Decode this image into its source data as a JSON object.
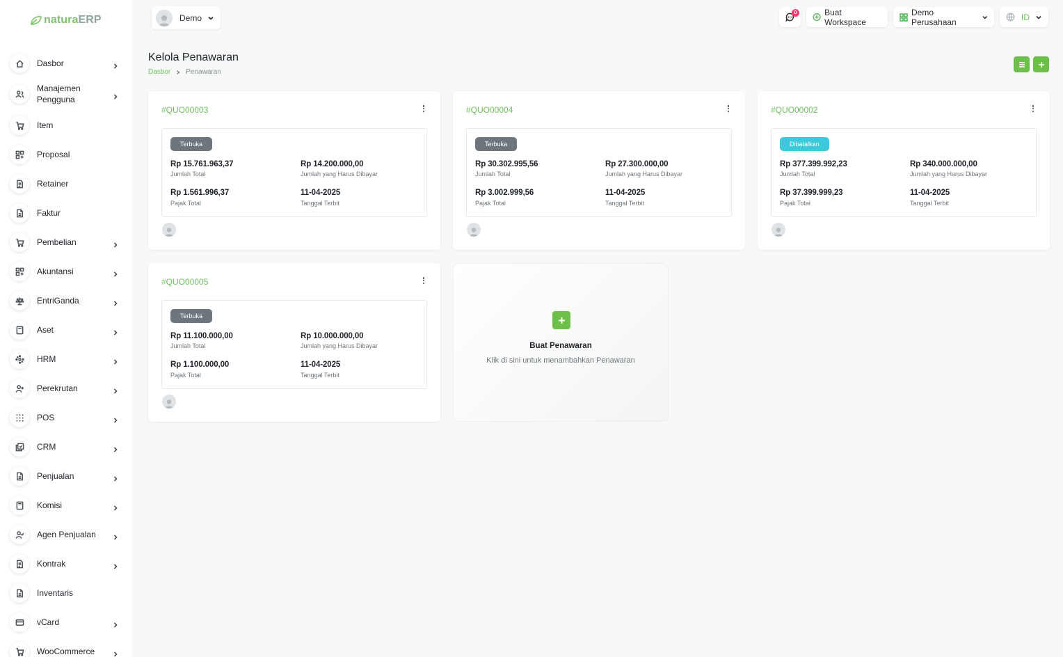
{
  "brand": {
    "part1": "natura",
    "part2": "ERP"
  },
  "sidebar": {
    "items": [
      {
        "label": "Dasbor",
        "icon": "home-icon",
        "chevron": true
      },
      {
        "label": "Manajemen Pengguna",
        "icon": "users-icon",
        "chevron": true
      },
      {
        "label": "Item",
        "icon": "cart-icon",
        "chevron": false
      },
      {
        "label": "Proposal",
        "icon": "grid-icon",
        "chevron": false
      },
      {
        "label": "Retainer",
        "icon": "file-icon",
        "chevron": false
      },
      {
        "label": "Faktur",
        "icon": "document-icon",
        "chevron": false
      },
      {
        "label": "Pembelian",
        "icon": "cart-icon",
        "chevron": true
      },
      {
        "label": "Akuntansi",
        "icon": "grid-icon",
        "chevron": true
      },
      {
        "label": "EntriGanda",
        "icon": "scale-icon",
        "chevron": true
      },
      {
        "label": "Aset",
        "icon": "calculator-icon",
        "chevron": true
      },
      {
        "label": "HRM",
        "icon": "network-icon",
        "chevron": true
      },
      {
        "label": "Perekrutan",
        "icon": "user-plus-icon",
        "chevron": true
      },
      {
        "label": "POS",
        "icon": "dots-grid-icon",
        "chevron": true
      },
      {
        "label": "CRM",
        "icon": "layers-icon",
        "chevron": true
      },
      {
        "label": "Penjualan",
        "icon": "document-icon",
        "chevron": true
      },
      {
        "label": "Komisi",
        "icon": "calculator-icon",
        "chevron": true
      },
      {
        "label": "Agen Penjualan",
        "icon": "user-check-icon",
        "chevron": true
      },
      {
        "label": "Kontrak",
        "icon": "file-icon",
        "chevron": true
      },
      {
        "label": "Inventaris",
        "icon": "document-icon",
        "chevron": false
      },
      {
        "label": "vCard",
        "icon": "card-icon",
        "chevron": true
      },
      {
        "label": "WooCommerce",
        "icon": "cart-icon",
        "chevron": true
      }
    ]
  },
  "topbar": {
    "user_name": "Demo",
    "notification_count": "0",
    "create_workspace": "Buat Workspace",
    "company": "Demo Perusahaan",
    "language": "ID"
  },
  "page": {
    "title": "Kelola Penawaran",
    "breadcrumb": {
      "home": "Dasbor",
      "current": "Penawaran"
    }
  },
  "labels": {
    "total": "Jumlah Total",
    "due": "Jumlah yang Harus Dibayar",
    "tax": "Pajak Total",
    "date": "Tanggal Terbit"
  },
  "quotes": [
    {
      "id": "#QUO00003",
      "status": "Terbuka",
      "total": "Rp 15.761.963,37",
      "due": "Rp 14.200.000,00",
      "tax": "Rp 1.561.996,37",
      "date": "11-04-2025"
    },
    {
      "id": "#QUO00004",
      "status": "Terbuka",
      "total": "Rp 30.302.995,56",
      "due": "Rp 27.300.000,00",
      "tax": "Rp 3.002.999,56",
      "date": "11-04-2025"
    },
    {
      "id": "#QUO00002",
      "status": "Dibatalkan",
      "total": "Rp 377.399.992,23",
      "due": "Rp 340.000.000,00",
      "tax": "Rp 37.399.999,23",
      "date": "11-04-2025"
    },
    {
      "id": "#QUO00005",
      "status": "Terbuka",
      "total": "Rp 11.100.000,00",
      "due": "Rp 10.000.000,00",
      "tax": "Rp 1.100.000,00",
      "date": "11-04-2025"
    }
  ],
  "create": {
    "title": "Buat Penawaran",
    "subtitle": "Klik di sini untuk menambahkan Penawaran"
  },
  "colors": {
    "accent": "#6cc04a",
    "status_open": "#6d757d",
    "status_cancelled": "#3ec8dc",
    "badge": "#ff3a6e"
  }
}
